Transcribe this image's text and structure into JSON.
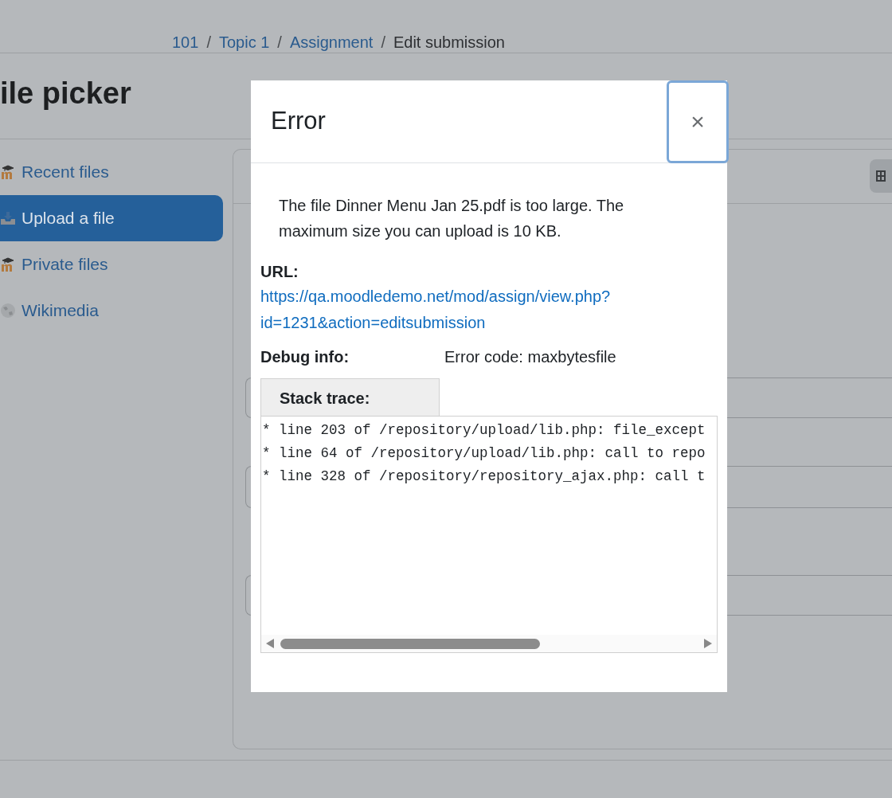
{
  "breadcrumb": [
    {
      "label": "101",
      "kind": "link"
    },
    {
      "separator": "/",
      "label": "Topic 1",
      "kind": "link"
    },
    {
      "separator": "/",
      "label": "Assignment",
      "kind": "link"
    },
    {
      "separator": "/",
      "label": "Edit submission",
      "kind": "current"
    }
  ],
  "page_heading": "ile picker",
  "repositories": [
    {
      "label": "Recent files",
      "kind": "moodle",
      "selected": false
    },
    {
      "label": "Upload a file",
      "kind": "upload",
      "selected": true
    },
    {
      "label": "Private files",
      "kind": "moodle",
      "selected": false
    },
    {
      "label": "Wikimedia",
      "kind": "globe",
      "selected": false
    }
  ],
  "dialog": {
    "title": "Error",
    "close": "×",
    "message": "The file Dinner Menu Jan 25.pdf is too large. The maximum size you can upload is 10 KB.",
    "url_label": "URL:",
    "url": "https://qa.moodledemo.net/mod/assign/view.php?id=1231&action=editsubmission",
    "debug_label": "Debug info:",
    "debug_value": "Error code: maxbytesfile",
    "stack_tab": "Stack trace:",
    "stack_lines": [
      "* line 203 of /repository/upload/lib.php: file_except",
      "* line 64 of /repository/upload/lib.php: call to repo",
      "* line 328 of /repository/repository_ajax.php: call t"
    ]
  }
}
